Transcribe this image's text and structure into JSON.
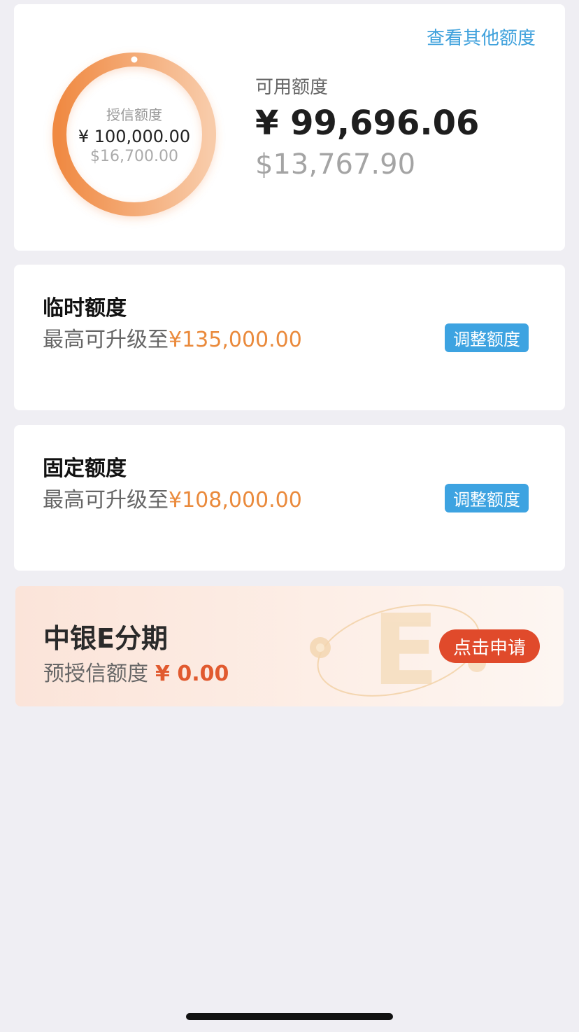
{
  "credit_overview": {
    "view_other_label": "查看其他额度",
    "ring": {
      "label": "授信额度",
      "cny": "¥ 100,000.00",
      "usd": "$16,700.00",
      "ring_color_start": "#f08a43",
      "ring_color_end": "#f8cba9"
    },
    "available": {
      "label": "可用额度",
      "cny": "¥ 99,696.06",
      "usd": "$13,767.90"
    }
  },
  "temporary_limit": {
    "title": "临时额度",
    "desc_prefix": "最高可升级至",
    "amount": "¥135,000.00",
    "button_label": "调整额度"
  },
  "fixed_limit": {
    "title": "固定额度",
    "desc_prefix": "最高可升级至",
    "amount": "¥108,000.00",
    "button_label": "调整额度"
  },
  "installment_promo": {
    "title": "中银E分期",
    "desc_prefix": "预授信额度",
    "amount": "¥ 0.00",
    "button_label": "点击申请",
    "decor_letter": "E"
  },
  "colors": {
    "background": "#efeef3",
    "link_blue": "#3fa1dc",
    "button_blue": "#3da3e1",
    "amount_orange": "#ea8a3c",
    "promo_red": "#e04a2b"
  }
}
